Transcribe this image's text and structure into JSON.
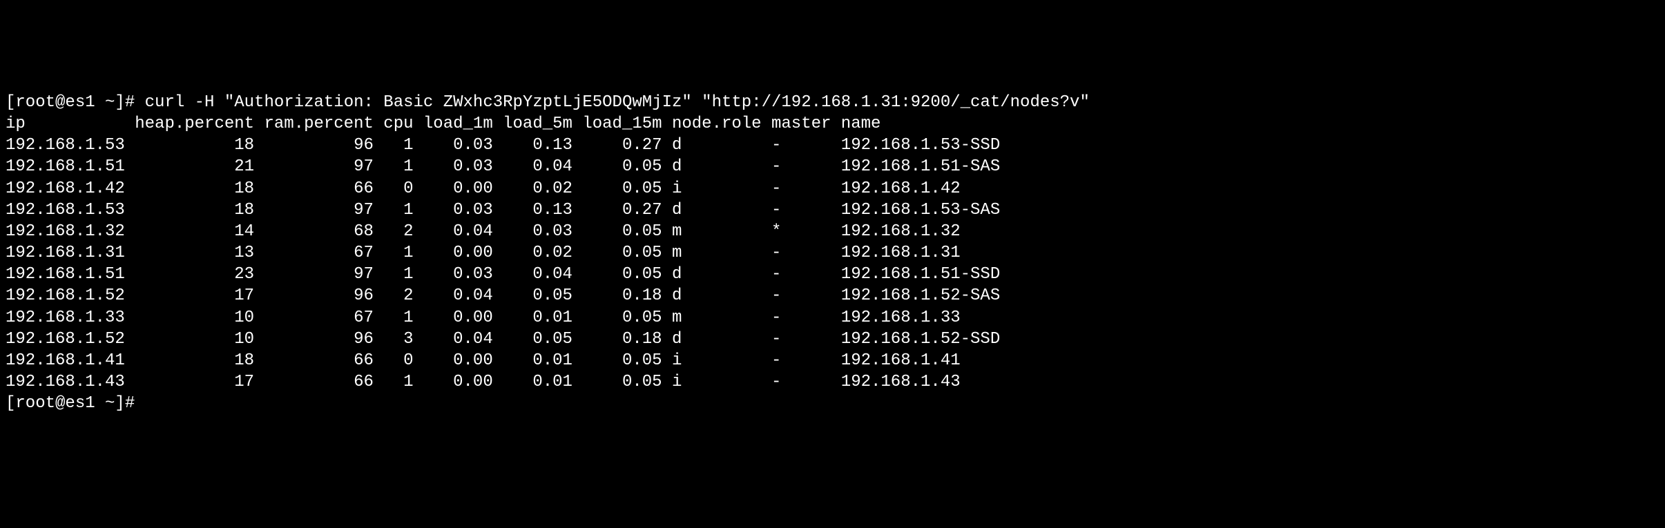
{
  "prompt": {
    "user_host": "[root@es1 ~]#",
    "command": "curl -H \"Authorization: Basic ZWxhc3RpYzptLjE5ODQwMjIz\" \"http://192.168.1.31:9200/_cat/nodes?v\""
  },
  "headers": {
    "ip": "ip",
    "heap_percent": "heap.percent",
    "ram_percent": "ram.percent",
    "cpu": "cpu",
    "load_1m": "load_1m",
    "load_5m": "load_5m",
    "load_15m": "load_15m",
    "node_role": "node.role",
    "master": "master",
    "name": "name"
  },
  "rows": [
    {
      "ip": "192.168.1.53",
      "heap": "18",
      "ram": "96",
      "cpu": "1",
      "l1": "0.03",
      "l5": "0.13",
      "l15": "0.27",
      "role": "d",
      "master": "-",
      "name": "192.168.1.53-SSD"
    },
    {
      "ip": "192.168.1.51",
      "heap": "21",
      "ram": "97",
      "cpu": "1",
      "l1": "0.03",
      "l5": "0.04",
      "l15": "0.05",
      "role": "d",
      "master": "-",
      "name": "192.168.1.51-SAS"
    },
    {
      "ip": "192.168.1.42",
      "heap": "18",
      "ram": "66",
      "cpu": "0",
      "l1": "0.00",
      "l5": "0.02",
      "l15": "0.05",
      "role": "i",
      "master": "-",
      "name": "192.168.1.42"
    },
    {
      "ip": "192.168.1.53",
      "heap": "18",
      "ram": "97",
      "cpu": "1",
      "l1": "0.03",
      "l5": "0.13",
      "l15": "0.27",
      "role": "d",
      "master": "-",
      "name": "192.168.1.53-SAS"
    },
    {
      "ip": "192.168.1.32",
      "heap": "14",
      "ram": "68",
      "cpu": "2",
      "l1": "0.04",
      "l5": "0.03",
      "l15": "0.05",
      "role": "m",
      "master": "*",
      "name": "192.168.1.32"
    },
    {
      "ip": "192.168.1.31",
      "heap": "13",
      "ram": "67",
      "cpu": "1",
      "l1": "0.00",
      "l5": "0.02",
      "l15": "0.05",
      "role": "m",
      "master": "-",
      "name": "192.168.1.31"
    },
    {
      "ip": "192.168.1.51",
      "heap": "23",
      "ram": "97",
      "cpu": "1",
      "l1": "0.03",
      "l5": "0.04",
      "l15": "0.05",
      "role": "d",
      "master": "-",
      "name": "192.168.1.51-SSD"
    },
    {
      "ip": "192.168.1.52",
      "heap": "17",
      "ram": "96",
      "cpu": "2",
      "l1": "0.04",
      "l5": "0.05",
      "l15": "0.18",
      "role": "d",
      "master": "-",
      "name": "192.168.1.52-SAS"
    },
    {
      "ip": "192.168.1.33",
      "heap": "10",
      "ram": "67",
      "cpu": "1",
      "l1": "0.00",
      "l5": "0.01",
      "l15": "0.05",
      "role": "m",
      "master": "-",
      "name": "192.168.1.33"
    },
    {
      "ip": "192.168.1.52",
      "heap": "10",
      "ram": "96",
      "cpu": "3",
      "l1": "0.04",
      "l5": "0.05",
      "l15": "0.18",
      "role": "d",
      "master": "-",
      "name": "192.168.1.52-SSD"
    },
    {
      "ip": "192.168.1.41",
      "heap": "18",
      "ram": "66",
      "cpu": "0",
      "l1": "0.00",
      "l5": "0.01",
      "l15": "0.05",
      "role": "i",
      "master": "-",
      "name": "192.168.1.41"
    },
    {
      "ip": "192.168.1.43",
      "heap": "17",
      "ram": "66",
      "cpu": "1",
      "l1": "0.00",
      "l5": "0.01",
      "l15": "0.05",
      "role": "i",
      "master": "-",
      "name": "192.168.1.43"
    }
  ],
  "prompt_end": "[root@es1 ~]#",
  "col_widths": {
    "ip": 13,
    "heap": 12,
    "ram": 11,
    "cpu": 3,
    "l1": 7,
    "l5": 7,
    "l15": 8,
    "role": 9,
    "master": 6,
    "name": 20
  }
}
